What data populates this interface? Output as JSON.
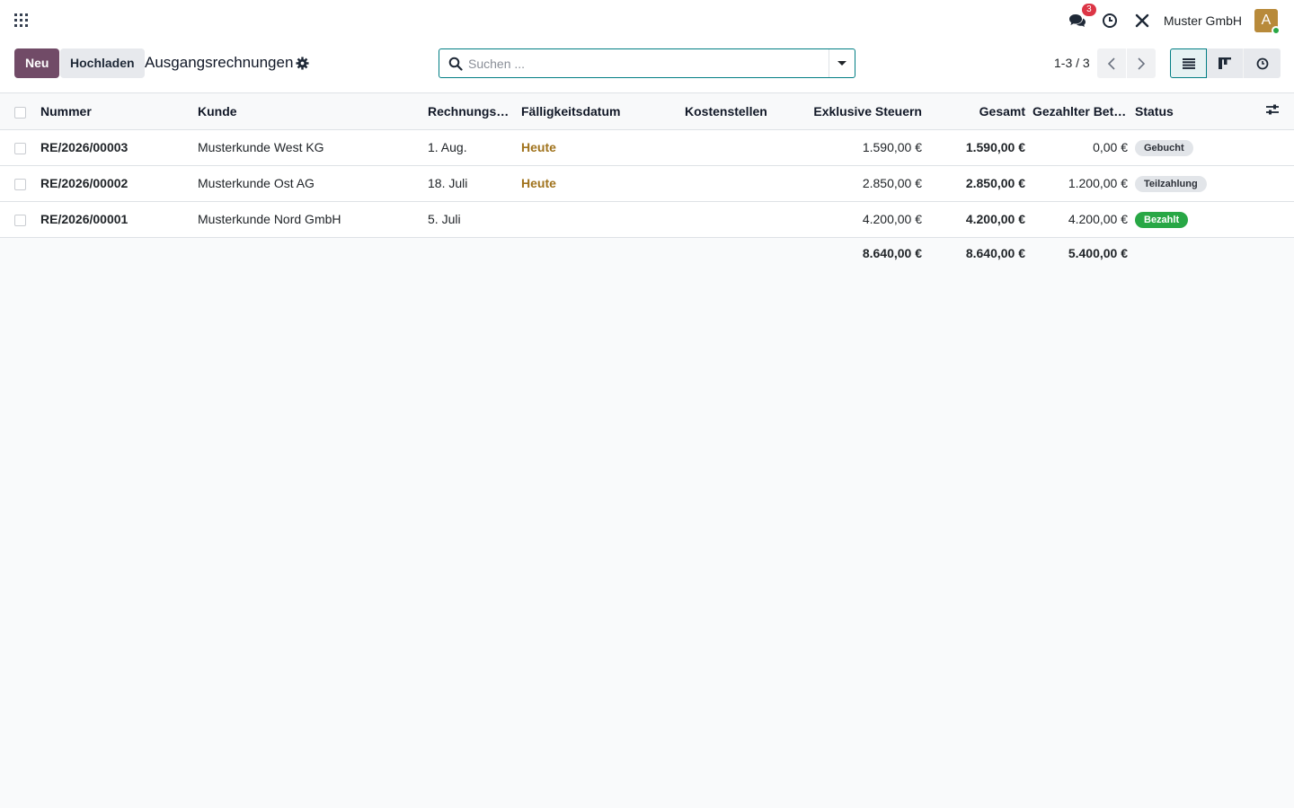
{
  "navbar": {
    "messages_count": "3",
    "company": "Muster GmbH",
    "avatar_letter": "A"
  },
  "control": {
    "new_label": "Neu",
    "upload_label": "Hochladen",
    "title": "Ausgangsrechnungen",
    "search_placeholder": "Suchen ...",
    "pager": "1-3 / 3"
  },
  "table": {
    "headers": {
      "number": "Nummer",
      "customer": "Kunde",
      "invoice_date": "Rechnungsdatum",
      "due_date": "Fälligkeitsdatum",
      "cost_centers": "Kostenstellen",
      "untaxed": "Exklusive Steuern",
      "total": "Gesamt",
      "paid": "Gezahlter Betrag",
      "status": "Status"
    },
    "rows": [
      {
        "number": "RE/2026/00003",
        "customer": "Musterkunde West KG",
        "invoice_date": "1. Aug.",
        "due_date": "Heute",
        "cost_centers": "",
        "untaxed": "1.590,00 €",
        "total": "1.590,00 €",
        "paid": "0,00 €",
        "status": "Gebucht"
      },
      {
        "number": "RE/2026/00002",
        "customer": "Musterkunde Ost AG",
        "invoice_date": "18. Juli",
        "due_date": "Heute",
        "cost_centers": "",
        "untaxed": "2.850,00 €",
        "total": "2.850,00 €",
        "paid": "1.200,00 €",
        "status": "Teilzahlung"
      },
      {
        "number": "RE/2026/00001",
        "customer": "Musterkunde Nord GmbH",
        "invoice_date": "5. Juli",
        "due_date": "",
        "cost_centers": "",
        "untaxed": "4.200,00 €",
        "total": "4.200,00 €",
        "paid": "4.200,00 €",
        "status": "Bezahlt"
      }
    ],
    "totals": {
      "untaxed": "8.640,00 €",
      "total": "8.640,00 €",
      "paid": "5.400,00 €"
    }
  },
  "colors": {
    "primary": "#714b67",
    "accent": "#017e84",
    "warning_text": "#a0731d",
    "paid_badge": "#28a745",
    "neutral_badge": "#e2e5e9"
  }
}
